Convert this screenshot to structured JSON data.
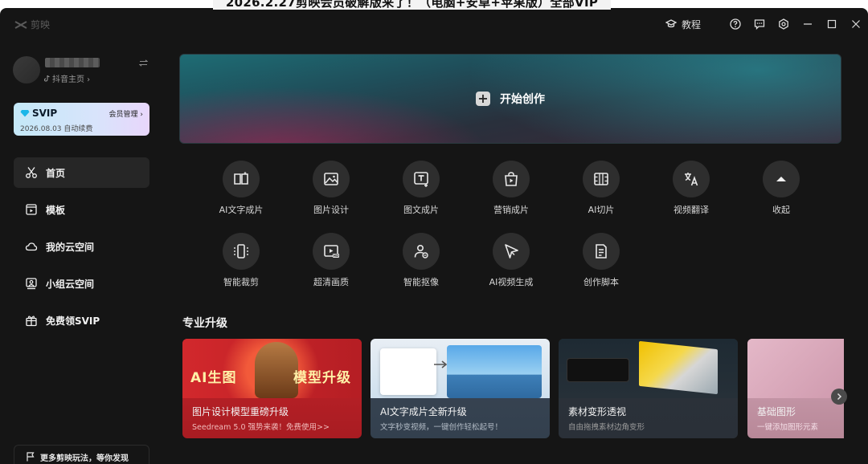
{
  "overlay": {
    "title": "2026.2.27剪映会员破解版来了！（电脑+安卓+苹果版）全部VIP"
  },
  "app": {
    "logo_text": "剪映"
  },
  "titlebar": {
    "tutorial_label": "教程"
  },
  "profile": {
    "douyin_link": "抖音主页 ›"
  },
  "svip": {
    "badge": "SVIP",
    "manage_label": "会员管理 ›",
    "expire_text": "2026.08.03 自动续费"
  },
  "nav": {
    "items": [
      {
        "label": "首页",
        "icon": "scissors-icon"
      },
      {
        "label": "模板",
        "icon": "template-icon"
      },
      {
        "label": "我的云空间",
        "icon": "cloud-icon"
      },
      {
        "label": "小组云空间",
        "icon": "group-cloud-icon"
      },
      {
        "label": "免费领SVIP",
        "icon": "gift-icon"
      }
    ]
  },
  "bottom_link": {
    "label": "更多剪映玩法，等你发现"
  },
  "hero": {
    "label": "开始创作"
  },
  "tools": {
    "items": [
      {
        "label": "AI文字成片"
      },
      {
        "label": "图片设计"
      },
      {
        "label": "图文成片"
      },
      {
        "label": "营销成片"
      },
      {
        "label": "AI切片"
      },
      {
        "label": "视频翻译"
      },
      {
        "label": "收起"
      },
      {
        "label": "智能裁剪"
      },
      {
        "label": "超清画质"
      },
      {
        "label": "智能抠像"
      },
      {
        "label": "AI视频生成"
      },
      {
        "label": "创作脚本"
      }
    ]
  },
  "pro": {
    "section_title": "专业升级",
    "cards": [
      {
        "title": "图片设计模型重磅升级",
        "subtitle": "Seedream 5.0 强势来袭！免费使用>>",
        "overlay_left": "AI生图",
        "overlay_right": "模型升级"
      },
      {
        "title": "AI文字成片全新升级",
        "subtitle": "文字秒变视频，一键创作轻松起号！"
      },
      {
        "title": "素材变形透视",
        "subtitle": "自由拖拽素材边角变形"
      },
      {
        "title": "基础图形",
        "subtitle": "一键添加图形元素"
      }
    ]
  }
}
